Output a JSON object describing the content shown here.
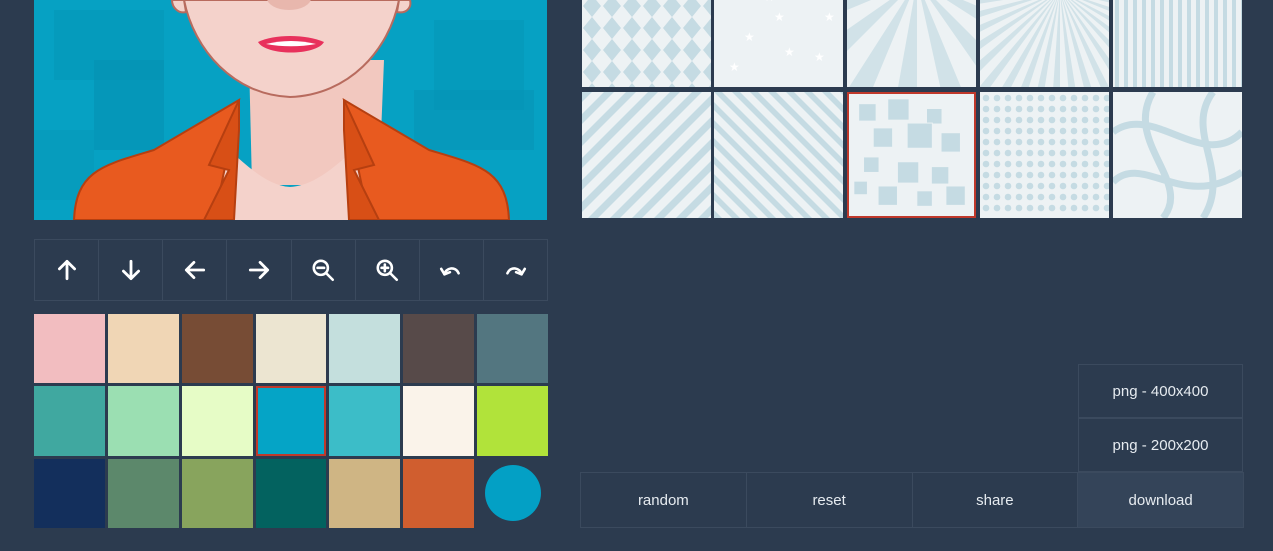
{
  "preview": {
    "background_color": "#06a1c3",
    "jacket_color": "#e85a1f",
    "skin_color": "#f4d2cb",
    "lip_color": "#e8315c"
  },
  "toolbar": {
    "buttons": [
      {
        "name": "move-up",
        "icon": "arrow-up-icon"
      },
      {
        "name": "move-down",
        "icon": "arrow-down-icon"
      },
      {
        "name": "move-left",
        "icon": "arrow-left-icon"
      },
      {
        "name": "move-right",
        "icon": "arrow-right-icon"
      },
      {
        "name": "zoom-out",
        "icon": "zoom-out-icon"
      },
      {
        "name": "zoom-in",
        "icon": "zoom-in-icon"
      },
      {
        "name": "rotate-left",
        "icon": "undo-icon"
      },
      {
        "name": "rotate-right",
        "icon": "redo-icon"
      }
    ]
  },
  "swatches": {
    "colors": [
      "#f2bdc0",
      "#f0d6b5",
      "#774c35",
      "#ece5d1",
      "#c4dfdd",
      "#574a49",
      "#537680",
      "#40a8a0",
      "#9bdfb2",
      "#e6fcc6",
      "#05a4c6",
      "#3cbdc8",
      "#faf3ea",
      "#b1e33a",
      "#132f5c",
      "#5c886b",
      "#88a45d",
      "#03625f",
      "#cfb584",
      "#d05e2f",
      "#03a0c5"
    ],
    "selected_index": 10,
    "circle_index": 20
  },
  "patterns": {
    "items": [
      "harlequin-pattern",
      "stars-pattern",
      "sunburst-pattern",
      "rays-pattern",
      "vertical-stripes-pattern",
      "diagonal-stripes-right-pattern",
      "diagonal-stripes-left-pattern",
      "squares-pattern",
      "dots-pattern",
      "curves-pattern"
    ],
    "selected_index": 7,
    "color": "#c5dbe3"
  },
  "download": {
    "png_large": "png - 400x400",
    "png_small": "png - 200x200"
  },
  "bottom_bar": {
    "random": "random",
    "reset": "reset",
    "share": "share",
    "download": "download"
  }
}
